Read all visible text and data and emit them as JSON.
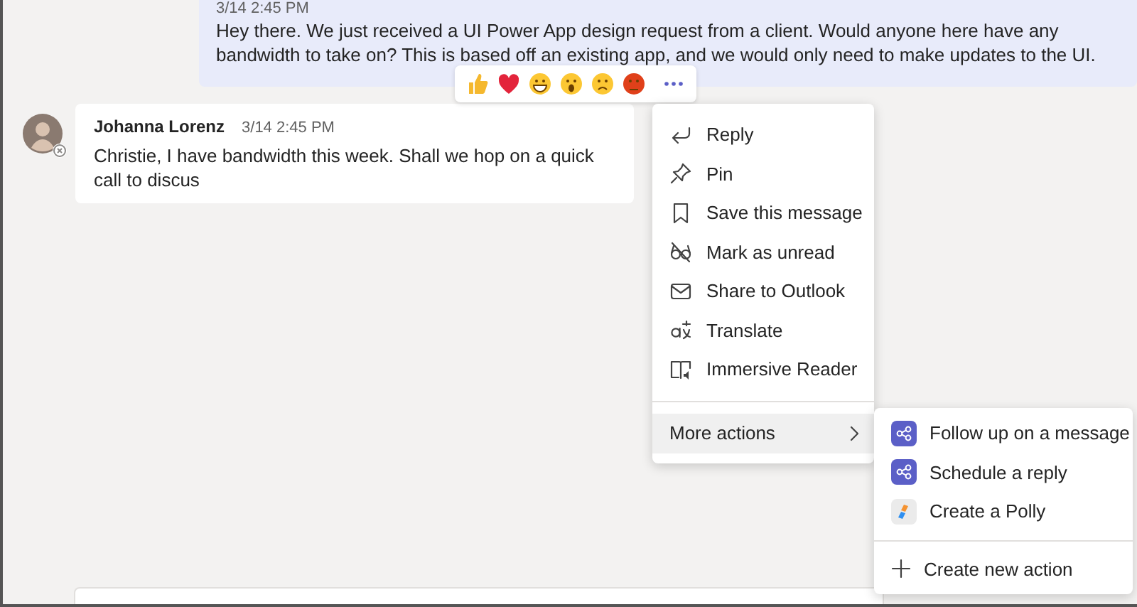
{
  "conversation": [
    {
      "mine": true,
      "timestamp": "3/14 2:45 PM",
      "text": "Hey there. We just received a UI Power App design request from a client. Would anyone here have any bandwidth to take on? This is based off an existing app, and we would only need to make updates to the UI."
    },
    {
      "mine": false,
      "author": "Johanna Lorenz",
      "timestamp": "3/14 2:45 PM",
      "text": "Christie, I have bandwidth this week. Shall we hop on a quick call to discus"
    }
  ],
  "context_menu": {
    "items": [
      {
        "label": "Reply",
        "selected": false
      },
      {
        "label": "Pin",
        "selected": false
      },
      {
        "label": "Save this message",
        "selected": false
      },
      {
        "label": "Mark as unread",
        "selected": false
      },
      {
        "label": "Share to Outlook",
        "selected": false
      },
      {
        "label": "Translate",
        "selected": false
      },
      {
        "label": "Immersive Reader",
        "selected": false
      },
      {
        "label": "More actions",
        "selected": true,
        "kind": "submenu"
      }
    ]
  },
  "submenu": {
    "items": [
      {
        "label": "Follow up on a message",
        "selected": false,
        "kind": "app"
      },
      {
        "label": "Schedule a reply",
        "selected": false,
        "kind": "app"
      },
      {
        "label": "Create a Polly",
        "selected": false,
        "kind": "polly"
      }
    ],
    "footer": "Create new action"
  }
}
